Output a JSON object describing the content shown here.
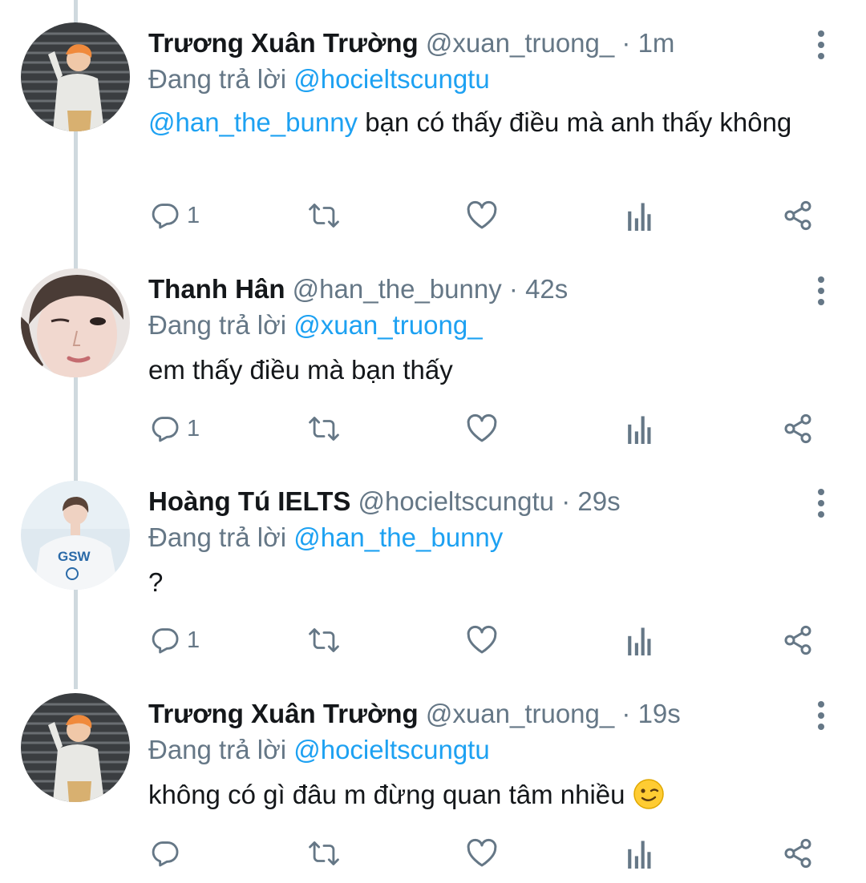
{
  "tweets": [
    {
      "name": "Trương Xuân Trường",
      "handle": "@xuan_truong_",
      "time": "· 1m",
      "reply_prefix": "Đang trả lời",
      "reply_to": "@hocieltscungtu",
      "text_mention": "@han_the_bunny",
      "text": " bạn có thấy điều mà anh thấy không",
      "reply_count": "1",
      "avatar": "person-orange-hair-avatar"
    },
    {
      "name": "Thanh Hân",
      "handle": "@han_the_bunny",
      "time": "· 42s",
      "reply_prefix": "Đang trả lời",
      "reply_to": "@xuan_truong_",
      "text_mention": "",
      "text": "em thấy điều mà bạn thấy",
      "reply_count": "1",
      "avatar": "person-closeup-winking-avatar"
    },
    {
      "name": "Hoàng Tú IELTS",
      "handle": "@hocieltscungtu",
      "time": "· 29s",
      "reply_prefix": "Đang trả lời",
      "reply_to": "@han_the_bunny",
      "text_mention": "",
      "text": "?",
      "reply_count": "1",
      "avatar": "person-gsw-shirt-avatar"
    },
    {
      "name": "Trương Xuân Trường",
      "handle": "@xuan_truong_",
      "time": "· 19s",
      "reply_prefix": "Đang trả lời",
      "reply_to": "@hocieltscungtu",
      "text_mention": "",
      "text": "không có gì đâu m đừng quan tâm nhiều",
      "reply_count": "",
      "avatar": "person-orange-hair-avatar",
      "emoji": "winking-face-emoji"
    }
  ],
  "colors": {
    "mention": "#1da1f2",
    "secondary_text": "#657786",
    "primary_text": "#14171a",
    "thread_line": "#cfd9de"
  },
  "icons": [
    "reply-icon",
    "retweet-icon",
    "like-icon",
    "analytics-icon",
    "share-icon",
    "more-options-icon"
  ]
}
